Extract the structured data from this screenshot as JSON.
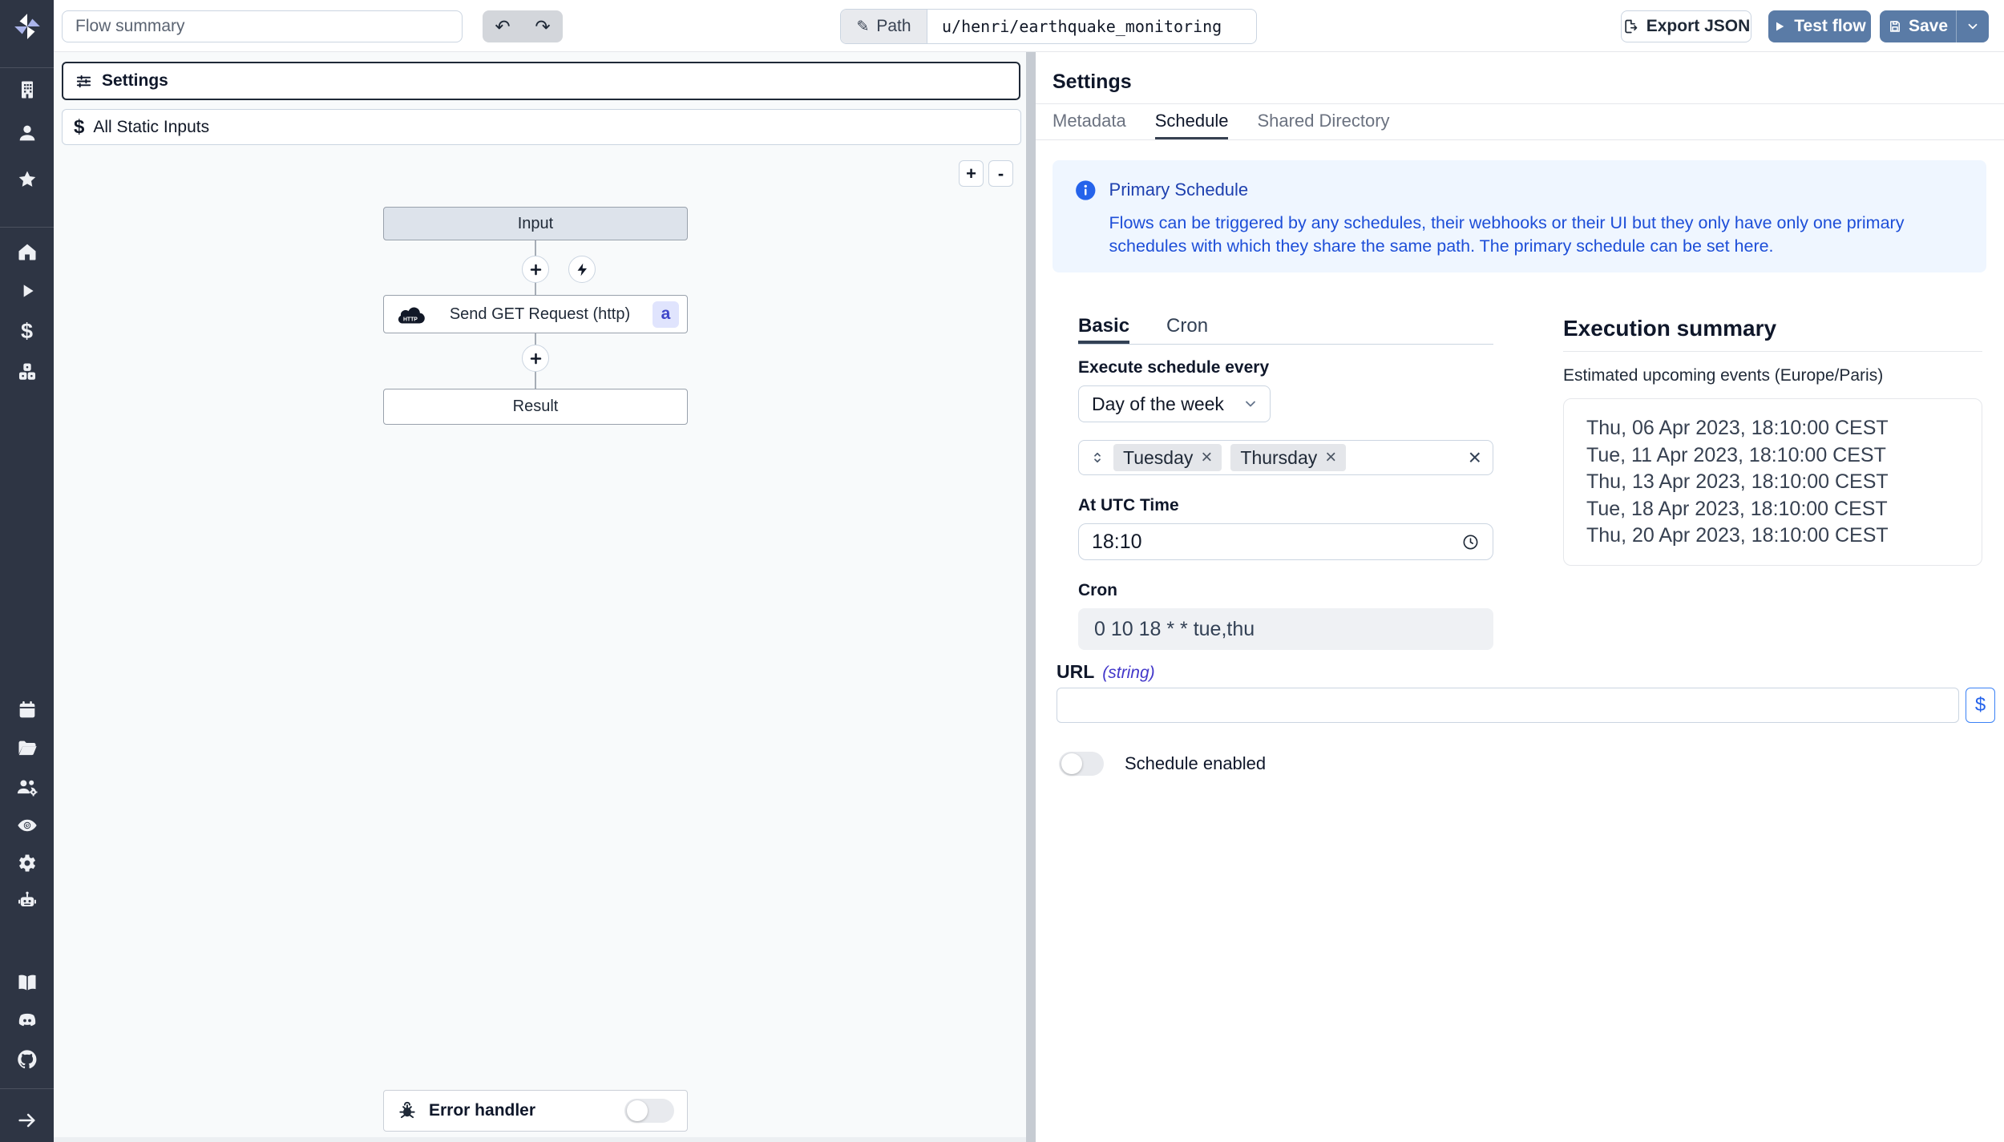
{
  "topbar": {
    "flow_summary_placeholder": "Flow summary",
    "path_label": "Path",
    "path_value": "u/henri/earthquake_monitoring",
    "export_json_label": "Export JSON",
    "test_flow_label": "Test flow",
    "save_label": "Save"
  },
  "flow_editor": {
    "settings_label": "Settings",
    "static_inputs_label": "All Static Inputs",
    "static_inputs_icon": "$",
    "zoom_in_label": "+",
    "zoom_out_label": "-",
    "nodes": {
      "input_label": "Input",
      "step_label": "Send GET Request (http)",
      "step_badge": "a",
      "result_label": "Result",
      "error_handler_label": "Error handler",
      "error_handler_enabled": false
    }
  },
  "settings_panel": {
    "title": "Settings",
    "tabs": [
      {
        "label": "Metadata"
      },
      {
        "label": "Schedule"
      },
      {
        "label": "Shared Directory"
      }
    ],
    "active_tab": "Schedule",
    "info_box": {
      "title": "Primary Schedule",
      "body": "Flows can be triggered by any schedules, their webhooks or their UI but they only have only one primary schedules with which they share the same path. The primary schedule can be set here."
    },
    "schedule_form": {
      "subtabs": [
        {
          "label": "Basic"
        },
        {
          "label": "Cron"
        }
      ],
      "active_subtab": "Basic",
      "execute_every_label": "Execute schedule every",
      "interval_value": "Day of the week",
      "selected_days": [
        "Tuesday",
        "Thursday"
      ],
      "utc_time_label": "At UTC Time",
      "utc_time_value": "18:10",
      "cron_label": "Cron",
      "cron_value": "0 10 18 * * tue,thu",
      "url_label": "URL",
      "url_type": "(string)",
      "url_value": "",
      "dollar_button_label": "$",
      "schedule_enabled_label": "Schedule enabled",
      "schedule_enabled": false
    },
    "execution_summary": {
      "title": "Execution summary",
      "subtitle": "Estimated upcoming events (Europe/Paris)",
      "events": [
        "Thu, 06 Apr 2023, 18:10:00 CEST",
        "Tue, 11 Apr 2023, 18:10:00 CEST",
        "Thu, 13 Apr 2023, 18:10:00 CEST",
        "Tue, 18 Apr 2023, 18:10:00 CEST",
        "Thu, 20 Apr 2023, 18:10:00 CEST"
      ]
    }
  },
  "colors": {
    "accent_blue": "#5a7ba6",
    "sidebar_bg": "#2e3544",
    "info_bg": "#eff6ff",
    "info_text": "#1d4ed8",
    "badge_bg": "#e0e4fd",
    "badge_text": "#3f46c9",
    "link_blue": "#3b82f6"
  }
}
